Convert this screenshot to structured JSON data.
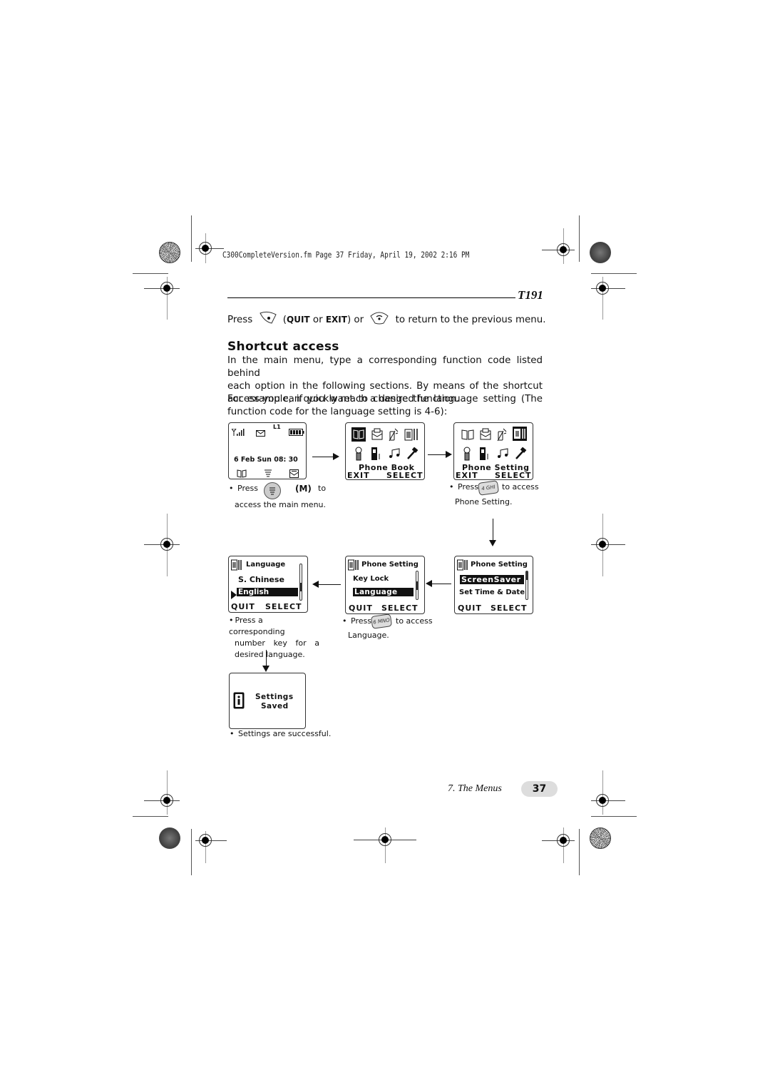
{
  "print_header": {
    "info": "C300CompleteVersion.fm  Page 37  Friday, April 19, 2002  2:16 PM"
  },
  "model": "T191",
  "intro": {
    "press": "Press",
    "quit": "QUIT",
    "or1": " or ",
    "exit": "EXIT",
    "or2": ") or",
    "open_paren": "(",
    "rest": "to return to the previous menu.",
    "key_left_icon": "soft-key-left-icon",
    "key_end_icon": "end-key-icon"
  },
  "section": {
    "title": "Shortcut access",
    "para1_lines": [
      "In the main menu, type a corresponding function code listed behind",
      "each option in the following sections. By means of the shortcut",
      "access you can quickly reach a desired function."
    ],
    "para2_lines": [
      "For example, if you want to change the language setting (The",
      "function code for the language setting is 4-6):"
    ]
  },
  "screens": {
    "idle": {
      "line1": "L1",
      "date": "6 Feb Sun 08: 30",
      "icons": [
        "signal-icon",
        "envelope-icon",
        "battery-icon",
        "phonebook-icon",
        "menu-icon",
        "message-icon"
      ]
    },
    "main_menu_1": {
      "label": "Phone Book",
      "left": "EXIT",
      "right": "SELECT"
    },
    "main_menu_2": {
      "label": "Phone Setting",
      "left": "EXIT",
      "right": "SELECT"
    },
    "phone_setting_1": {
      "title": "Phone Setting",
      "items": [
        "ScreenSaver",
        "Set Time & Date"
      ],
      "selected": "ScreenSaver",
      "left": "QUIT",
      "right": "SELECT"
    },
    "phone_setting_2": {
      "title": "Phone Setting",
      "items": [
        "Key Lock",
        "Language"
      ],
      "selected": "Language",
      "left": "QUIT",
      "right": "SELECT"
    },
    "language": {
      "title": "Language",
      "items": [
        "S. Chinese",
        "English"
      ],
      "selected": "English",
      "left": "QUIT",
      "right": "SELECT"
    },
    "saved": {
      "line1": "Settings",
      "line2": "Saved"
    }
  },
  "captions": {
    "c1_press": "Press",
    "c1_key": "(M)",
    "c1_to": "to",
    "c1_line2": "access the main menu.",
    "c2_press": "Press",
    "c2_key": "4 GHI",
    "c2_rest": "to access",
    "c2_line2": "Phone Setting.",
    "c3_press": "Press",
    "c3_key": "6 MNO",
    "c3_rest": "to access",
    "c3_line2": "Language.",
    "c4_lines": [
      "Press a corresponding",
      "number key for a",
      "desired language."
    ],
    "c5": "Settings are successful."
  },
  "footer": {
    "chapter": "7. The Menus",
    "page": "37"
  }
}
